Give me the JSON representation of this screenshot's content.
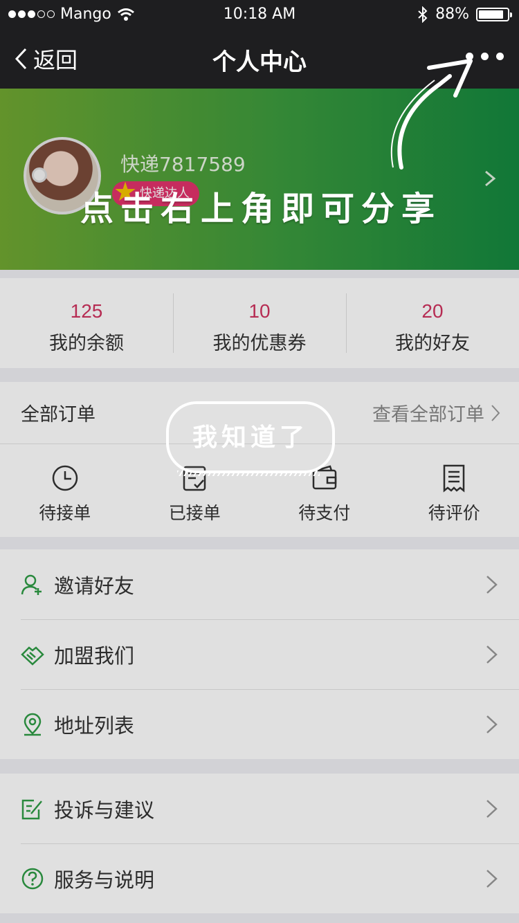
{
  "status_bar": {
    "carrier": "Mango",
    "time": "10:18 AM",
    "battery": "88%",
    "battery_level": 0.88
  },
  "nav": {
    "back_label": "返回",
    "title": "个人中心"
  },
  "profile": {
    "username": "快递7817589",
    "badge": "快递达人"
  },
  "overlay": {
    "hint": "点击右上角即可分享",
    "dismiss": "我知道了"
  },
  "stats": [
    {
      "value": "125",
      "label": "我的余额"
    },
    {
      "value": "10",
      "label": "我的优惠券"
    },
    {
      "value": "20",
      "label": "我的好友"
    }
  ],
  "orders": {
    "title": "全部订单",
    "view_all": "查看全部订单",
    "items": [
      {
        "label": "待接单",
        "icon": "clock-icon"
      },
      {
        "label": "已接单",
        "icon": "checklist-icon"
      },
      {
        "label": "待支付",
        "icon": "wallet-icon"
      },
      {
        "label": "待评价",
        "icon": "receipt-icon"
      }
    ]
  },
  "menu_group_1": [
    {
      "label": "邀请好友",
      "icon": "add-user-icon"
    },
    {
      "label": "加盟我们",
      "icon": "handshake-icon"
    },
    {
      "label": "地址列表",
      "icon": "location-pin-icon"
    }
  ],
  "menu_group_2": [
    {
      "label": "投诉与建议",
      "icon": "edit-icon"
    },
    {
      "label": "服务与说明",
      "icon": "help-icon"
    }
  ],
  "colors": {
    "accent_green": "#2f9c46",
    "stat_red": "#d0335f",
    "badge_pink": "#e2336b",
    "nav_bg": "#1e1e20"
  }
}
